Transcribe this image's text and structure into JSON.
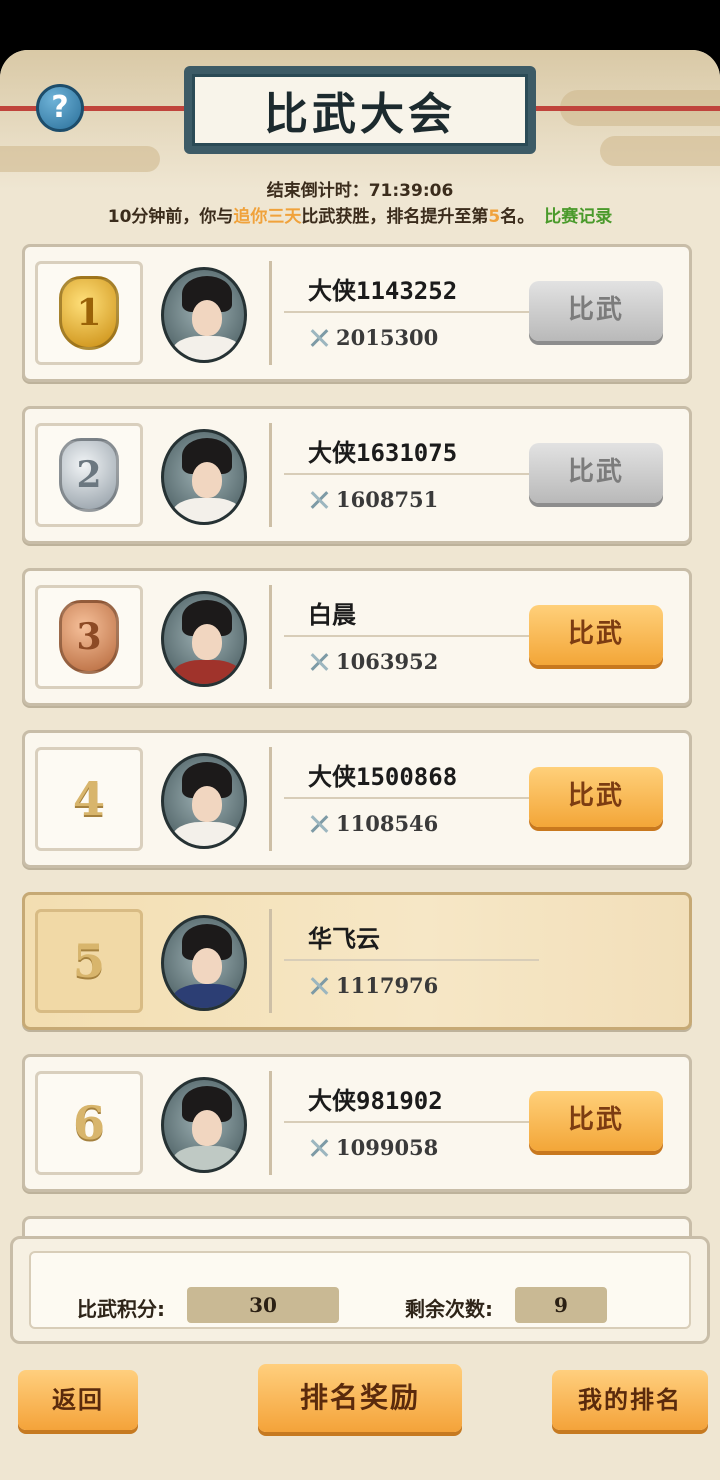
{
  "header": {
    "title": "比武大会",
    "help_label": "?"
  },
  "status": {
    "countdown": "结束倒计时：71:39:06",
    "notice_prefix": "10分钟前，你与",
    "notice_opponent": "追你三天",
    "notice_middle": "比武获胜，排名提升至第",
    "notice_rank": "5",
    "notice_suffix": "名。",
    "record_link": "比赛记录"
  },
  "players": [
    {
      "rank": "1",
      "name": "大侠1143252",
      "power": "2015300",
      "button": "比武"
    },
    {
      "rank": "2",
      "name": "大侠1631075",
      "power": "1608751",
      "button": "比武"
    },
    {
      "rank": "3",
      "name": "白晨",
      "power": "1063952",
      "button": "比武"
    },
    {
      "rank": "4",
      "name": "大侠1500868",
      "power": "1108546",
      "button": "比武"
    },
    {
      "rank": "5",
      "name": "华飞云",
      "power": "1117976",
      "button": ""
    },
    {
      "rank": "6",
      "name": "大侠981902",
      "power": "1099058",
      "button": "比武"
    }
  ],
  "score": {
    "points_label": "比武积分:",
    "points_value": "30",
    "remaining_label": "剩余次数:",
    "remaining_value": "9"
  },
  "footer": {
    "back_label": "返回",
    "rewards_label": "排名奖励",
    "my_rank_label": "我的排名"
  }
}
